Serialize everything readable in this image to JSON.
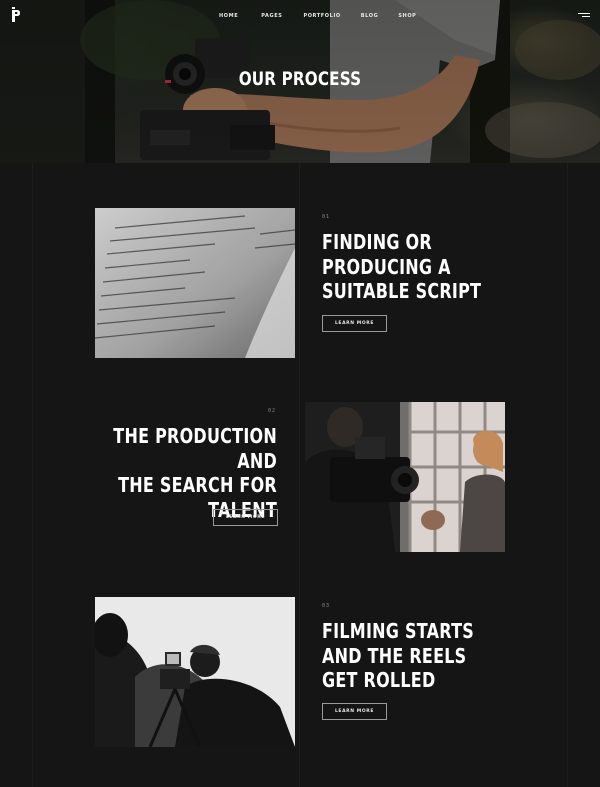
{
  "header": {
    "logo_letter": "P",
    "nav": [
      {
        "label": "HOME"
      },
      {
        "label": "PAGES"
      },
      {
        "label": "PORTFOLIO"
      },
      {
        "label": "BLOG"
      },
      {
        "label": "SHOP"
      }
    ],
    "menu_icon": "hamburger-menu-icon"
  },
  "hero": {
    "title": "OUR PROCESS"
  },
  "steps": [
    {
      "number": "01",
      "title_lines": [
        "FINDING OR",
        "PRODUCING A",
        "SUITABLE SCRIPT"
      ],
      "button": "LEARN MORE"
    },
    {
      "number": "02",
      "title_lines": [
        "THE PRODUCTION AND",
        "THE SEARCH FOR",
        "TALENT"
      ],
      "button": "LEARN MORE"
    },
    {
      "number": "03",
      "title_lines": [
        "FILMING STARTS",
        "AND THE REELS",
        "GET ROLLED"
      ],
      "button": "LEARN MORE"
    }
  ],
  "colors": {
    "background": "#151515",
    "text": "#ffffff",
    "button_border": "#9a9a9a"
  }
}
